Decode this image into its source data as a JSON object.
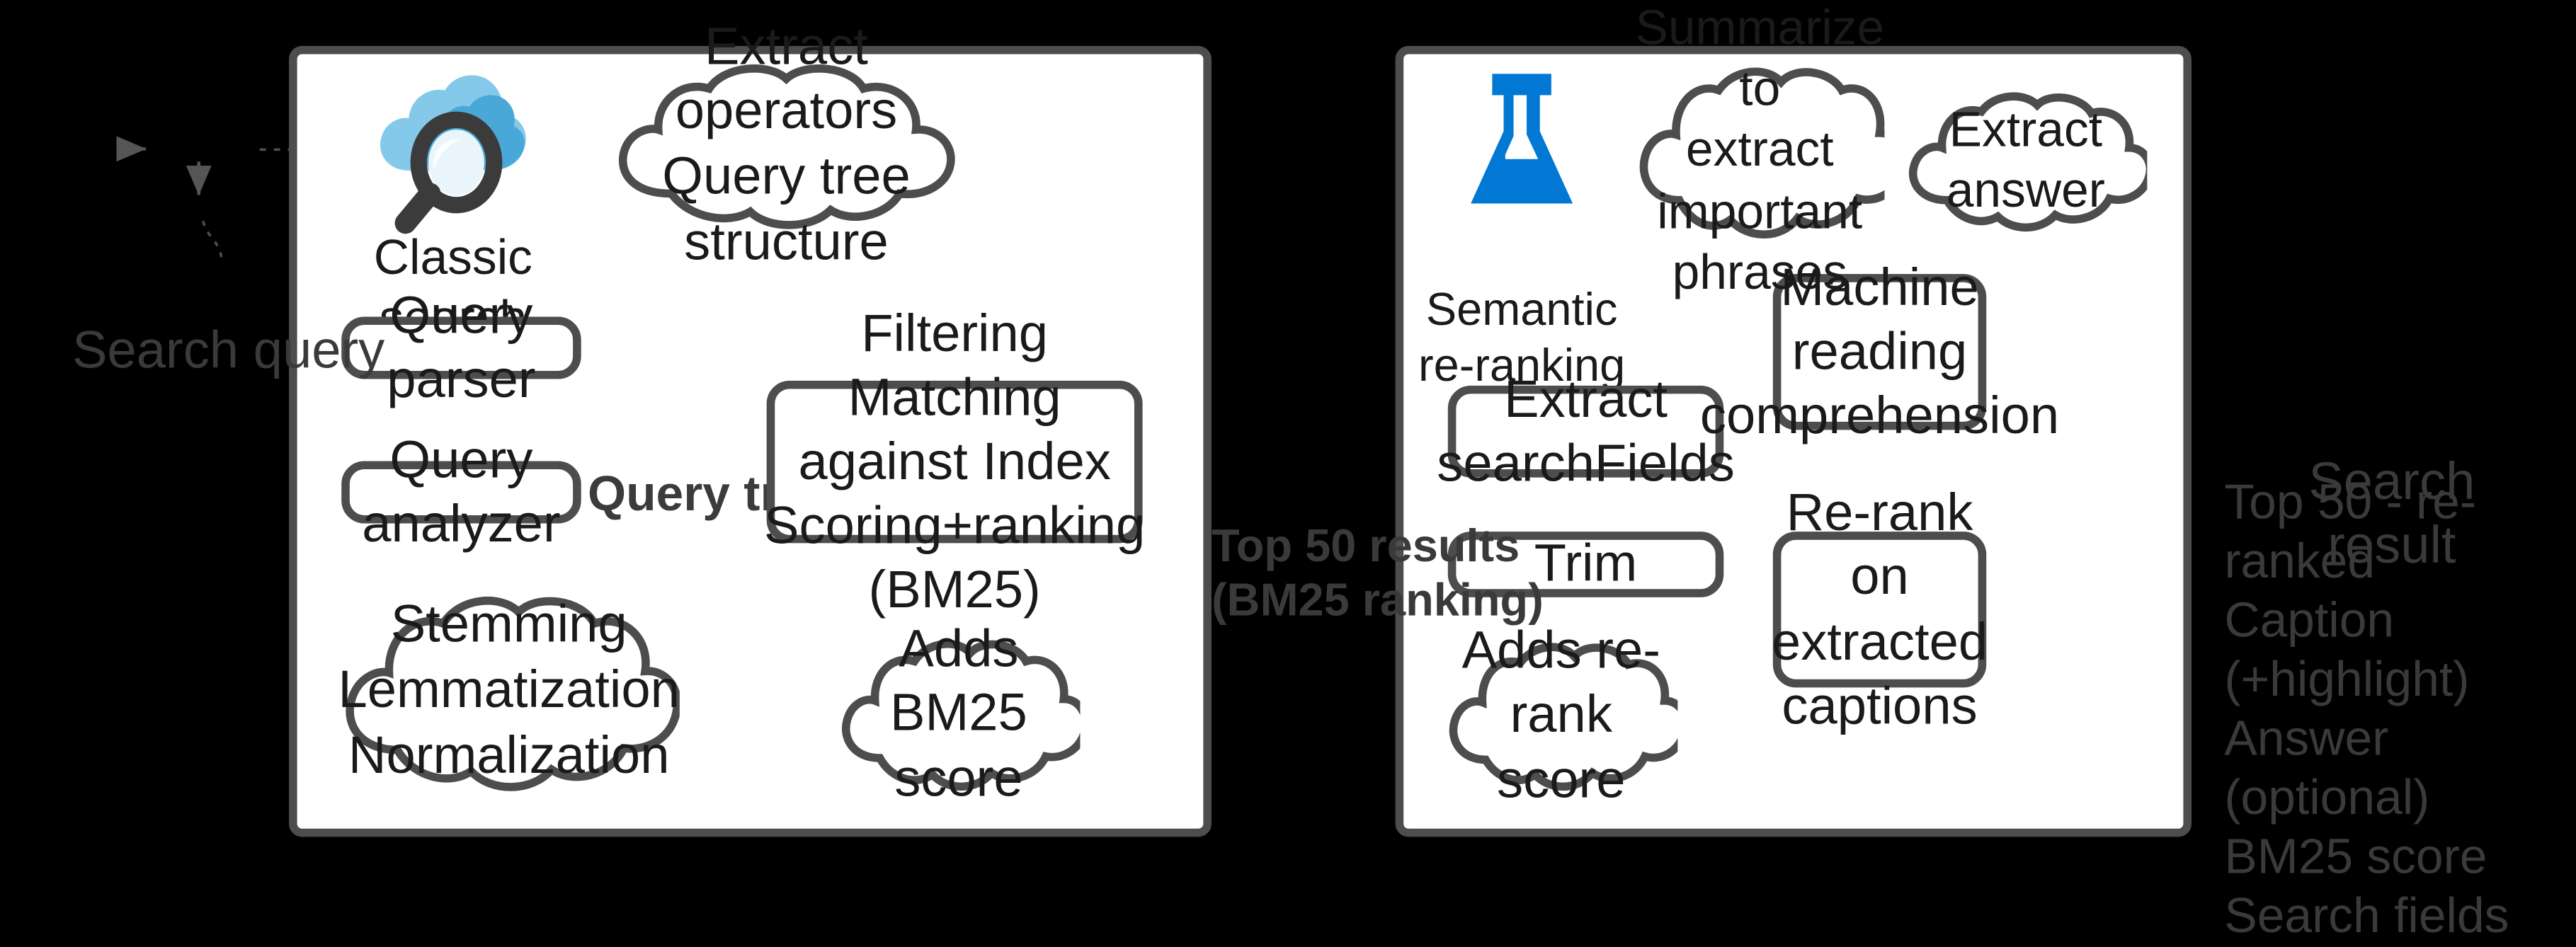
{
  "theme": {
    "background": "#000000",
    "panel_fill": "#ffffff",
    "stroke": "#4d4d4d",
    "text_on_white": "#1a1a1a",
    "text_on_black": "#3a3a3a",
    "accent_blue": "#0078d4",
    "cloud_icon_light": "#7fc4e8",
    "cloud_icon_mid": "#4aa8d8",
    "lens_dark": "#3b3b3b"
  },
  "flow_in": {
    "label": "Search query"
  },
  "left_panel": {
    "icon_caption": "Classic search",
    "icon_name": "classic-search-cloud-magnifier-icon",
    "clouds": [
      {
        "id": "extract-operators",
        "text": "Extract operators\nQuery tree structure"
      },
      {
        "id": "stemming",
        "text": "Stemming\nLemmatization\nNormalization"
      },
      {
        "id": "adds-bm25-score",
        "text": "Adds BM25\nscore"
      }
    ],
    "nodes": [
      {
        "id": "query-parser",
        "text": "Query parser"
      },
      {
        "id": "query-analyzer",
        "text": "Query analyzer"
      },
      {
        "id": "filtering",
        "text": "Filtering\nMatching against Index\nScoring+ranking (BM25)"
      }
    ],
    "edge_labels": [
      {
        "id": "query-tree",
        "text": "Query tree"
      }
    ]
  },
  "between_panels": {
    "label": "Top 50 results\n(BM25 ranking)"
  },
  "right_panel": {
    "icon_caption": "Semantic\nre-ranking",
    "icon_name": "semantic-reranking-flask-icon",
    "clouds": [
      {
        "id": "summarize",
        "text": "Summarize to\nextract important\nphrases"
      },
      {
        "id": "extract-answer",
        "text": "Extract answer"
      },
      {
        "id": "adds-rerank-score",
        "text": "Adds re-rank\nscore"
      }
    ],
    "nodes": [
      {
        "id": "extract-searchfields",
        "text": "Extract\nsearchFields"
      },
      {
        "id": "trim",
        "text": "Trim"
      },
      {
        "id": "machine-reading-comprehension",
        "text": "Machine\nreading\ncomprehension"
      },
      {
        "id": "rerank-extracted-captions",
        "text": "Re-rank on\nextracted\ncaptions"
      }
    ]
  },
  "flow_out": {
    "title": "Search\nresult",
    "items": [
      "Top 50 - re-ranked",
      "Caption (+highlight)",
      "Answer (optional)",
      "BM25 score",
      "Search fields"
    ]
  }
}
